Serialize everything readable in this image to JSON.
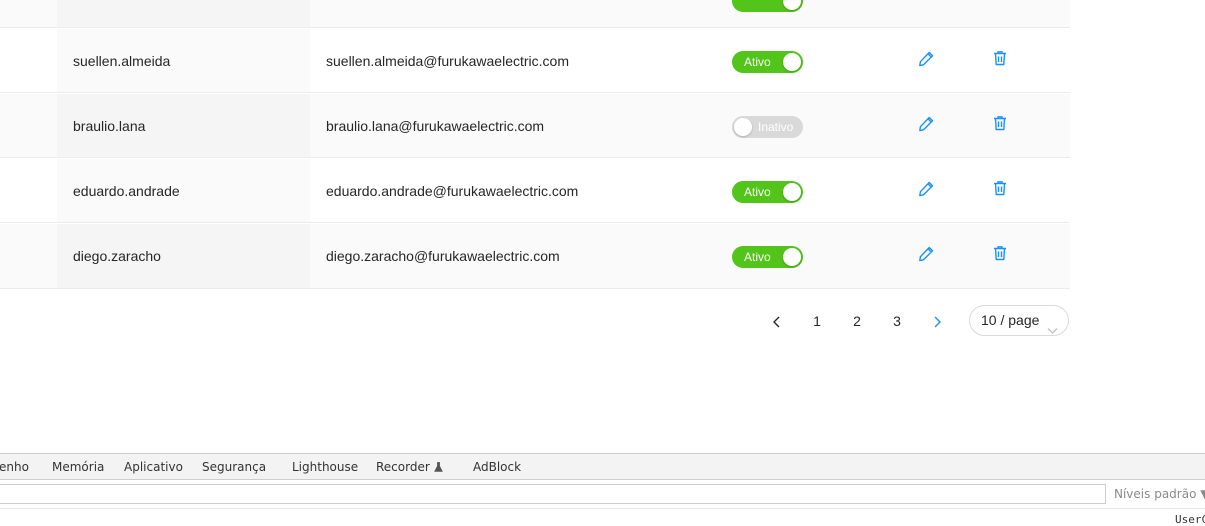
{
  "colors": {
    "accent": "#1890ff",
    "active": "#52c41a",
    "inactive": "#d9d9d9"
  },
  "table": {
    "rows": [
      {
        "username": "suellen.almeida",
        "email": "suellen.almeida@furukawaelectric.com",
        "status": "Ativo",
        "active": true
      },
      {
        "username": "braulio.lana",
        "email": "braulio.lana@furukawaelectric.com",
        "status": "Inativo",
        "active": false
      },
      {
        "username": "eduardo.andrade",
        "email": "eduardo.andrade@furukawaelectric.com",
        "status": "Ativo",
        "active": true
      },
      {
        "username": "diego.zaracho",
        "email": "diego.zaracho@furukawaelectric.com",
        "status": "Ativo",
        "active": true
      }
    ],
    "icons": {
      "edit": "pencil-icon",
      "delete": "trash-icon"
    }
  },
  "pagination": {
    "prev": "<",
    "pages": [
      "1",
      "2",
      "3"
    ],
    "next": ">",
    "page_size": "10 / page"
  },
  "devtools": {
    "tabs": [
      "enho",
      "Memória",
      "Aplicativo",
      "Segurança",
      "Lighthouse",
      "Recorder",
      "AdBlock"
    ],
    "levels": "Níveis padrão",
    "cut_text": "UserC"
  }
}
